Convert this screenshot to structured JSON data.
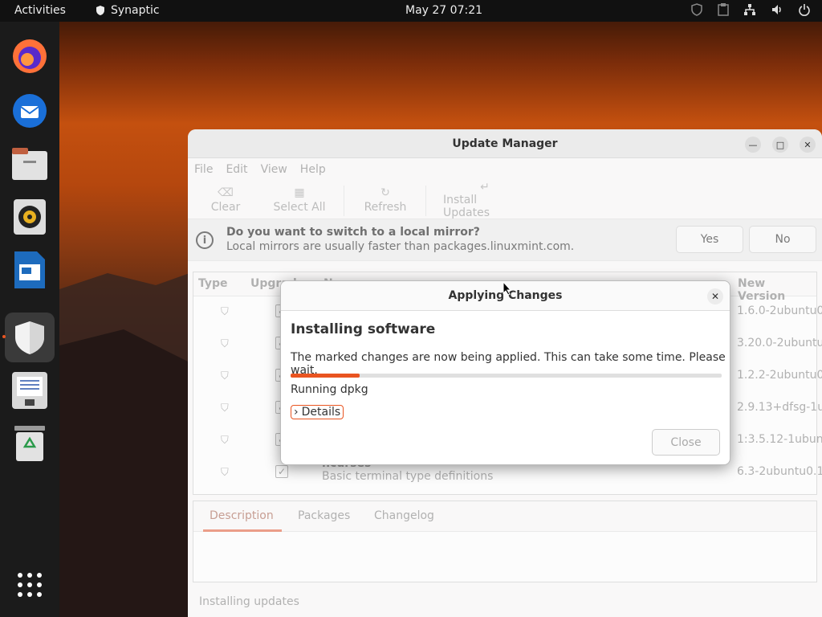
{
  "topbar": {
    "activities": "Activities",
    "app_name": "Synaptic",
    "clock": "May 27  07:21"
  },
  "window": {
    "title": "Update Manager",
    "menu": [
      "File",
      "Edit",
      "View",
      "Help"
    ],
    "toolbar": {
      "clear": "Clear",
      "select_all": "Select All",
      "refresh": "Refresh",
      "install_updates": "Install Updates"
    },
    "infobar": {
      "title": "Do you want to switch to a local mirror?",
      "subtitle": "Local mirrors are usually faster than packages.linuxmint.com.",
      "yes": "Yes",
      "no": "No"
    },
    "columns": {
      "type": "Type",
      "upgrade": "Upgrade",
      "name": "Name",
      "new_version": "New Version"
    },
    "rows": [
      {
        "name": "",
        "desc": "",
        "version": "1.6.0-2ubuntu0"
      },
      {
        "name": "",
        "desc": "",
        "version": "3.20.0-2ubuntu"
      },
      {
        "name": "",
        "desc": "",
        "version": "1.2.2-2ubuntu0"
      },
      {
        "name": "",
        "desc": "",
        "version": "2.9.13+dfsg-1u"
      },
      {
        "name": "",
        "desc": "",
        "version": "1:3.5.12-1ubun"
      },
      {
        "name": "ncurses",
        "desc": "Basic terminal type definitions",
        "version": "6.3-2ubuntu0.1"
      }
    ],
    "tabs": [
      "Description",
      "Packages",
      "Changelog"
    ],
    "status": "Installing updates"
  },
  "dialog": {
    "title": "Applying Changes",
    "heading": "Installing software",
    "message": "The marked changes are now being applied. This can take some time. Please wait.",
    "progress": 0.16,
    "status": "Running dpkg",
    "details": "Details",
    "close": "Close"
  },
  "icons": {
    "dock": [
      "firefox-icon",
      "thunderbird-icon",
      "files-icon",
      "rhythmbox-icon",
      "writer-icon",
      "mintupdate-icon",
      "document-icon",
      "trash-icon",
      "app-grid-icon"
    ]
  },
  "colors": {
    "accent": "#e95420"
  }
}
